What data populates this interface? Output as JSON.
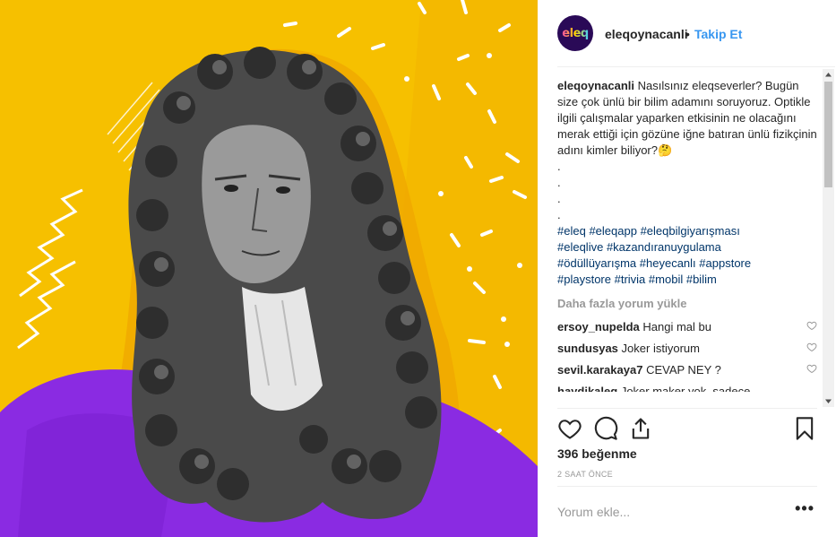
{
  "post": {
    "username": "eleqoynacanli",
    "dot": "•",
    "follow_label": "Takip Et",
    "avatar_text": "eleq",
    "caption_user": "eleqoynacanli",
    "caption_text": " Nasılsınız eleqseverler? Bugün size çok ünlü bir bilim adamını soruyoruz. Optikle ilgili çalışmalar yaparken etkisinin ne olacağını merak ettiği için gözüne iğne batıran ünlü fizikçinin adını kimler biliyor?🤔",
    "caption_dots": [
      ".",
      ".",
      ".",
      "."
    ],
    "hashtags": [
      "#eleq",
      "#eleqapp",
      "#eleqbilgiyarışması",
      "#eleqlive",
      "#kazandıranuygulama",
      "#ödüllüyarışma",
      "#heyecanlı",
      "#appstore",
      "#playstore",
      "#trivia",
      "#mobil",
      "#bilim"
    ],
    "load_more": "Daha fazla yorum yükle",
    "comments": [
      {
        "user": "ersoy_nupelda",
        "text": "Hangi mal bu"
      },
      {
        "user": "sundusyas",
        "text": "Joker istiyorum"
      },
      {
        "user": "sevil.karakaya7",
        "text": "CEVAP NEY ?"
      },
      {
        "user": "haydikaleq",
        "text": "Joker maker yok, sadece"
      }
    ],
    "likes": "396 beğenme",
    "time": "2 SAAT ÖNCE",
    "add_comment_placeholder": "Yorum ekle...",
    "more_label": "•••"
  },
  "colors": {
    "follow": "#3897f0",
    "hashtag": "#003569",
    "image_bg": "#f6c000",
    "robe": "#8a2be2"
  },
  "icons": [
    "heart-icon",
    "comment-icon",
    "share-icon",
    "bookmark-icon",
    "more-options-icon"
  ]
}
